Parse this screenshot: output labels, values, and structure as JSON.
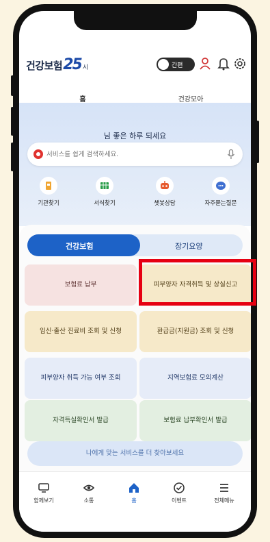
{
  "app": {
    "logo_text": "건강보험",
    "logo_number": "25",
    "logo_suffix": "시",
    "toggle_label": "간편"
  },
  "tabs": [
    {
      "label": "홈",
      "active": true
    },
    {
      "label": "건강모아",
      "active": false
    }
  ],
  "hero": {
    "greeting": "님 좋은 하루 되세요",
    "search_placeholder": "서비스를 쉽게 검색하세요."
  },
  "quick_links": [
    {
      "label": "기관찾기",
      "icon": "building-icon"
    },
    {
      "label": "서식찾기",
      "icon": "form-icon"
    },
    {
      "label": "챗봇상담",
      "icon": "chatbot-icon"
    },
    {
      "label": "자주묻는질문",
      "icon": "faq-icon"
    }
  ],
  "segments": [
    {
      "label": "건강보험",
      "active": true
    },
    {
      "label": "장기요양",
      "active": false
    }
  ],
  "cards": [
    {
      "label": "보험료 납부",
      "color": "pink"
    },
    {
      "label": "피부양자 자격취득 및 상실신고",
      "color": "yellow",
      "highlighted": true
    },
    {
      "label": "임신·출산 진료비 조회 및 신청",
      "color": "yellow"
    },
    {
      "label": "환급금(지원금) 조회 및 신청",
      "color": "yellow"
    },
    {
      "label": "피부양자 취득 가능 여부 조회",
      "color": "blue"
    },
    {
      "label": "지역보험료 모의계산",
      "color": "blue"
    },
    {
      "label": "자격득실확인서 발급",
      "color": "green"
    },
    {
      "label": "보험료 납부확인서 발급",
      "color": "green"
    }
  ],
  "more_button": "나에게 맞는 서비스를 더 찾아보세요",
  "bottom_nav": [
    {
      "label": "함께보기",
      "icon": "monitor-icon"
    },
    {
      "label": "소통",
      "icon": "eye-icon"
    },
    {
      "label": "홈",
      "icon": "home-icon",
      "active": true
    },
    {
      "label": "이벤트",
      "icon": "check-circle-icon"
    },
    {
      "label": "전체메뉴",
      "icon": "menu-icon"
    }
  ],
  "colors": {
    "accent": "#1d62c7",
    "highlight_border": "#e60012",
    "background": "#fbf4e1"
  }
}
